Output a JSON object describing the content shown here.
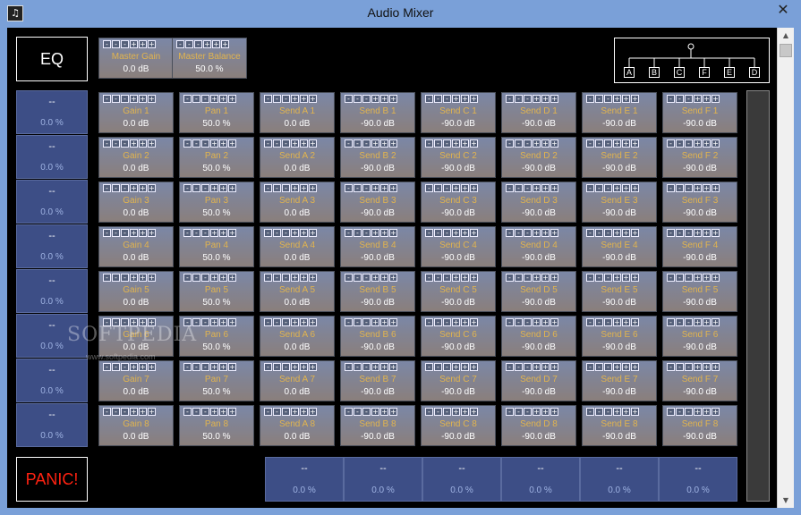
{
  "window": {
    "title": "Audio Mixer"
  },
  "buttons": {
    "eq": "EQ",
    "panic": "PANIC!"
  },
  "step_buttons": [
    "-",
    "-",
    "-",
    "+",
    "+",
    "+"
  ],
  "master": [
    {
      "label": "Master Gain",
      "value": "0.0 dB"
    },
    {
      "label": "Master Balance",
      "value": "50.0 %"
    }
  ],
  "routing": {
    "labels": [
      "A",
      "B",
      "C",
      "F",
      "E",
      "D"
    ]
  },
  "channel_meters": [
    {
      "top": "--",
      "bottom": "0.0 %"
    },
    {
      "top": "--",
      "bottom": "0.0 %"
    },
    {
      "top": "--",
      "bottom": "0.0 %"
    },
    {
      "top": "--",
      "bottom": "0.0 %"
    },
    {
      "top": "--",
      "bottom": "0.0 %"
    },
    {
      "top": "--",
      "bottom": "0.0 %"
    },
    {
      "top": "--",
      "bottom": "0.0 %"
    },
    {
      "top": "--",
      "bottom": "0.0 %"
    }
  ],
  "send_meters": [
    {
      "top": "--",
      "bottom": "0.0 %"
    },
    {
      "top": "--",
      "bottom": "0.0 %"
    },
    {
      "top": "--",
      "bottom": "0.0 %"
    },
    {
      "top": "--",
      "bottom": "0.0 %"
    },
    {
      "top": "--",
      "bottom": "0.0 %"
    },
    {
      "top": "--",
      "bottom": "0.0 %"
    }
  ],
  "rows": [
    [
      {
        "label": "Gain 1",
        "value": "0.0 dB"
      },
      {
        "label": "Pan 1",
        "value": "50.0 %"
      },
      {
        "label": "Send A 1",
        "value": "0.0 dB"
      },
      {
        "label": "Send B 1",
        "value": "-90.0 dB"
      },
      {
        "label": "Send C 1",
        "value": "-90.0 dB"
      },
      {
        "label": "Send D 1",
        "value": "-90.0 dB"
      },
      {
        "label": "Send E 1",
        "value": "-90.0 dB"
      },
      {
        "label": "Send F 1",
        "value": "-90.0 dB"
      }
    ],
    [
      {
        "label": "Gain 2",
        "value": "0.0 dB"
      },
      {
        "label": "Pan 2",
        "value": "50.0 %"
      },
      {
        "label": "Send A 2",
        "value": "0.0 dB"
      },
      {
        "label": "Send B 2",
        "value": "-90.0 dB"
      },
      {
        "label": "Send C 2",
        "value": "-90.0 dB"
      },
      {
        "label": "Send D 2",
        "value": "-90.0 dB"
      },
      {
        "label": "Send E 2",
        "value": "-90.0 dB"
      },
      {
        "label": "Send F 2",
        "value": "-90.0 dB"
      }
    ],
    [
      {
        "label": "Gain 3",
        "value": "0.0 dB"
      },
      {
        "label": "Pan 3",
        "value": "50.0 %"
      },
      {
        "label": "Send A 3",
        "value": "0.0 dB"
      },
      {
        "label": "Send B 3",
        "value": "-90.0 dB"
      },
      {
        "label": "Send C 3",
        "value": "-90.0 dB"
      },
      {
        "label": "Send D 3",
        "value": "-90.0 dB"
      },
      {
        "label": "Send E 3",
        "value": "-90.0 dB"
      },
      {
        "label": "Send F 3",
        "value": "-90.0 dB"
      }
    ],
    [
      {
        "label": "Gain 4",
        "value": "0.0 dB"
      },
      {
        "label": "Pan 4",
        "value": "50.0 %"
      },
      {
        "label": "Send A 4",
        "value": "0.0 dB"
      },
      {
        "label": "Send B 4",
        "value": "-90.0 dB"
      },
      {
        "label": "Send C 4",
        "value": "-90.0 dB"
      },
      {
        "label": "Send D 4",
        "value": "-90.0 dB"
      },
      {
        "label": "Send E 4",
        "value": "-90.0 dB"
      },
      {
        "label": "Send F 4",
        "value": "-90.0 dB"
      }
    ],
    [
      {
        "label": "Gain 5",
        "value": "0.0 dB"
      },
      {
        "label": "Pan 5",
        "value": "50.0 %"
      },
      {
        "label": "Send A 5",
        "value": "0.0 dB"
      },
      {
        "label": "Send B 5",
        "value": "-90.0 dB"
      },
      {
        "label": "Send C 5",
        "value": "-90.0 dB"
      },
      {
        "label": "Send D 5",
        "value": "-90.0 dB"
      },
      {
        "label": "Send E 5",
        "value": "-90.0 dB"
      },
      {
        "label": "Send F 5",
        "value": "-90.0 dB"
      }
    ],
    [
      {
        "label": "Gain 6",
        "value": "0.0 dB"
      },
      {
        "label": "Pan 6",
        "value": "50.0 %"
      },
      {
        "label": "Send A 6",
        "value": "0.0 dB"
      },
      {
        "label": "Send B 6",
        "value": "-90.0 dB"
      },
      {
        "label": "Send C 6",
        "value": "-90.0 dB"
      },
      {
        "label": "Send D 6",
        "value": "-90.0 dB"
      },
      {
        "label": "Send E 6",
        "value": "-90.0 dB"
      },
      {
        "label": "Send F 6",
        "value": "-90.0 dB"
      }
    ],
    [
      {
        "label": "Gain 7",
        "value": "0.0 dB"
      },
      {
        "label": "Pan 7",
        "value": "50.0 %"
      },
      {
        "label": "Send A 7",
        "value": "0.0 dB"
      },
      {
        "label": "Send B 7",
        "value": "-90.0 dB"
      },
      {
        "label": "Send C 7",
        "value": "-90.0 dB"
      },
      {
        "label": "Send D 7",
        "value": "-90.0 dB"
      },
      {
        "label": "Send E 7",
        "value": "-90.0 dB"
      },
      {
        "label": "Send F 7",
        "value": "-90.0 dB"
      }
    ],
    [
      {
        "label": "Gain 8",
        "value": "0.0 dB"
      },
      {
        "label": "Pan 8",
        "value": "50.0 %"
      },
      {
        "label": "Send A 8",
        "value": "0.0 dB"
      },
      {
        "label": "Send B 8",
        "value": "-90.0 dB"
      },
      {
        "label": "Send C 8",
        "value": "-90.0 dB"
      },
      {
        "label": "Send D 8",
        "value": "-90.0 dB"
      },
      {
        "label": "Send E 8",
        "value": "-90.0 dB"
      },
      {
        "label": "Send F 8",
        "value": "-90.0 dB"
      }
    ]
  ],
  "watermark": {
    "brand": "SOFTPEDIA",
    "url": "www.softpedia.com"
  }
}
